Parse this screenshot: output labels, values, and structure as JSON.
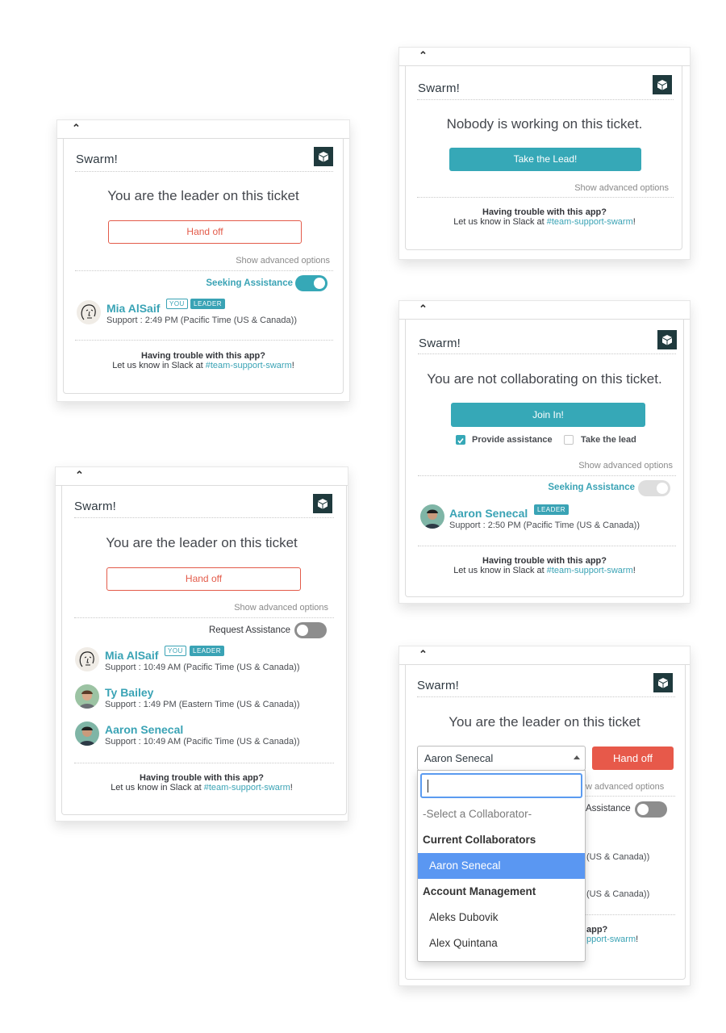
{
  "common": {
    "title": "Swarm!",
    "advanced": "Show advanced options",
    "trouble_title": "Having trouble with this app?",
    "trouble_prefix": "Let us know in Slack at ",
    "trouble_link": "#team-support-swarm",
    "trouble_suffix": "!",
    "you_badge": "YOU",
    "leader_badge": "LEADER",
    "collapse_glyph": "⌃"
  },
  "panel1": {
    "headline": "You are the leader on this ticket",
    "button": "Hand off",
    "toggle_label": "Seeking Assistance",
    "toggle_on": true,
    "users": [
      {
        "name": "Mia AlSaif",
        "sub": "Support : 2:49 PM (Pacific Time (US & Canada))",
        "you": true,
        "leader": true
      }
    ]
  },
  "panel2": {
    "headline": "Nobody is working on this ticket.",
    "button": "Take the Lead!"
  },
  "panel3": {
    "headline": "You are not collaborating on this ticket.",
    "button": "Join In!",
    "check1": "Provide assistance",
    "check1_checked": true,
    "check2": "Take the lead",
    "check2_checked": false,
    "toggle_label": "Seeking Assistance",
    "toggle_on": false,
    "users": [
      {
        "name": "Aaron Senecal",
        "sub": "Support : 2:50 PM (Pacific Time (US & Canada))",
        "leader": true
      }
    ]
  },
  "panel4": {
    "headline": "You are the leader on this ticket",
    "button": "Hand off",
    "toggle_label": "Request Assistance",
    "toggle_on": false,
    "users": [
      {
        "name": "Mia AlSaif",
        "sub": "Support : 10:49 AM (Pacific Time (US & Canada))",
        "you": true,
        "leader": true
      },
      {
        "name": "Ty Bailey",
        "sub": "Support : 1:49 PM (Eastern Time (US & Canada))"
      },
      {
        "name": "Aaron Senecal",
        "sub": "Support : 10:49 AM (Pacific Time (US & Canada))"
      }
    ]
  },
  "panel5": {
    "headline": "You are the leader on this ticket",
    "select_value": "Aaron Senecal",
    "button": "Hand off",
    "advanced_visible": "w advanced options",
    "toggle_label_visible": "Assistance",
    "row1_visible": "(US & Canada))",
    "row2_visible": "(US & Canada))",
    "trouble_title_visible": "app?",
    "trouble_link_visible": "pport-swarm",
    "trouble_suffix": "!",
    "dropdown": {
      "search_value": "",
      "placeholder_option": "-Select a Collaborator-",
      "group1": "Current Collaborators",
      "group1_items": [
        "Aaron Senecal"
      ],
      "group2": "Account Management",
      "group2_items": [
        "Aleks Dubovik",
        "Alex Quintana"
      ],
      "highlighted": "Aaron Senecal"
    }
  }
}
